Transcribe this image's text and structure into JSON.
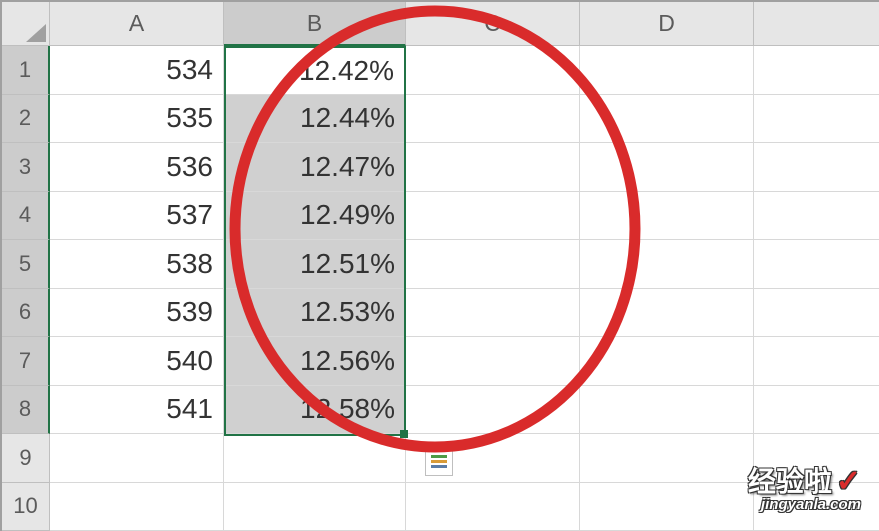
{
  "chart_data": {
    "type": "table",
    "columns": [
      "A",
      "B"
    ],
    "rows": [
      {
        "A": 534,
        "B": "12.42%"
      },
      {
        "A": 535,
        "B": "12.44%"
      },
      {
        "A": 536,
        "B": "12.47%"
      },
      {
        "A": 537,
        "B": "12.49%"
      },
      {
        "A": 538,
        "B": "12.51%"
      },
      {
        "A": 539,
        "B": "12.53%"
      },
      {
        "A": 540,
        "B": "12.56%"
      },
      {
        "A": 541,
        "B": "12.58%"
      }
    ],
    "selected_range": "B1:B8"
  },
  "headers": {
    "cols": [
      "A",
      "B",
      "C",
      "D",
      ""
    ],
    "rows": [
      "1",
      "2",
      "3",
      "4",
      "5",
      "6",
      "7",
      "8",
      "9",
      "10"
    ]
  },
  "cells": {
    "A": [
      "534",
      "535",
      "536",
      "537",
      "538",
      "539",
      "540",
      "541",
      "",
      ""
    ],
    "B": [
      "12.42%",
      "12.44%",
      "12.47%",
      "12.49%",
      "12.51%",
      "12.53%",
      "12.56%",
      "12.58%",
      "",
      ""
    ]
  },
  "active_cell_value": "12.42%",
  "watermark": {
    "title": "经验啦",
    "check": "✓",
    "url": "jingyanla.com"
  },
  "annotation_color": "#d92b2b"
}
